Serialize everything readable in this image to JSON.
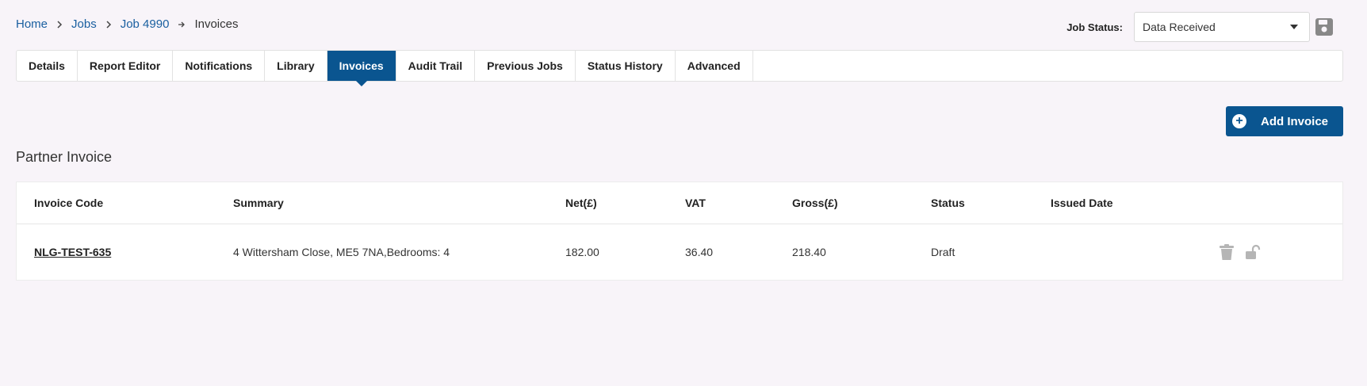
{
  "breadcrumb": {
    "items": [
      "Home",
      "Jobs",
      "Job 4990"
    ],
    "current": "Invoices"
  },
  "job_status": {
    "label": "Job Status:",
    "selected": "Data Received"
  },
  "tabs": [
    {
      "label": "Details"
    },
    {
      "label": "Report Editor"
    },
    {
      "label": "Notifications"
    },
    {
      "label": "Library"
    },
    {
      "label": "Invoices",
      "active": true
    },
    {
      "label": "Audit Trail"
    },
    {
      "label": "Previous Jobs"
    },
    {
      "label": "Status History"
    },
    {
      "label": "Advanced"
    }
  ],
  "add_invoice_label": "Add Invoice",
  "section_title": "Partner Invoice",
  "table": {
    "headers": [
      "Invoice Code",
      "Summary",
      "Net(£)",
      "VAT",
      "Gross(£)",
      "Status",
      "Issued Date"
    ],
    "rows": [
      {
        "code": "NLG-TEST-635",
        "summary": "4 Wittersham Close, ME5 7NA,Bedrooms: 4",
        "net": "182.00",
        "vat": "36.40",
        "gross": "218.40",
        "status": "Draft",
        "issued": ""
      }
    ]
  },
  "colors": {
    "primary": "#0a5590",
    "link": "#1a5fa0",
    "background": "#f8f4f9"
  }
}
